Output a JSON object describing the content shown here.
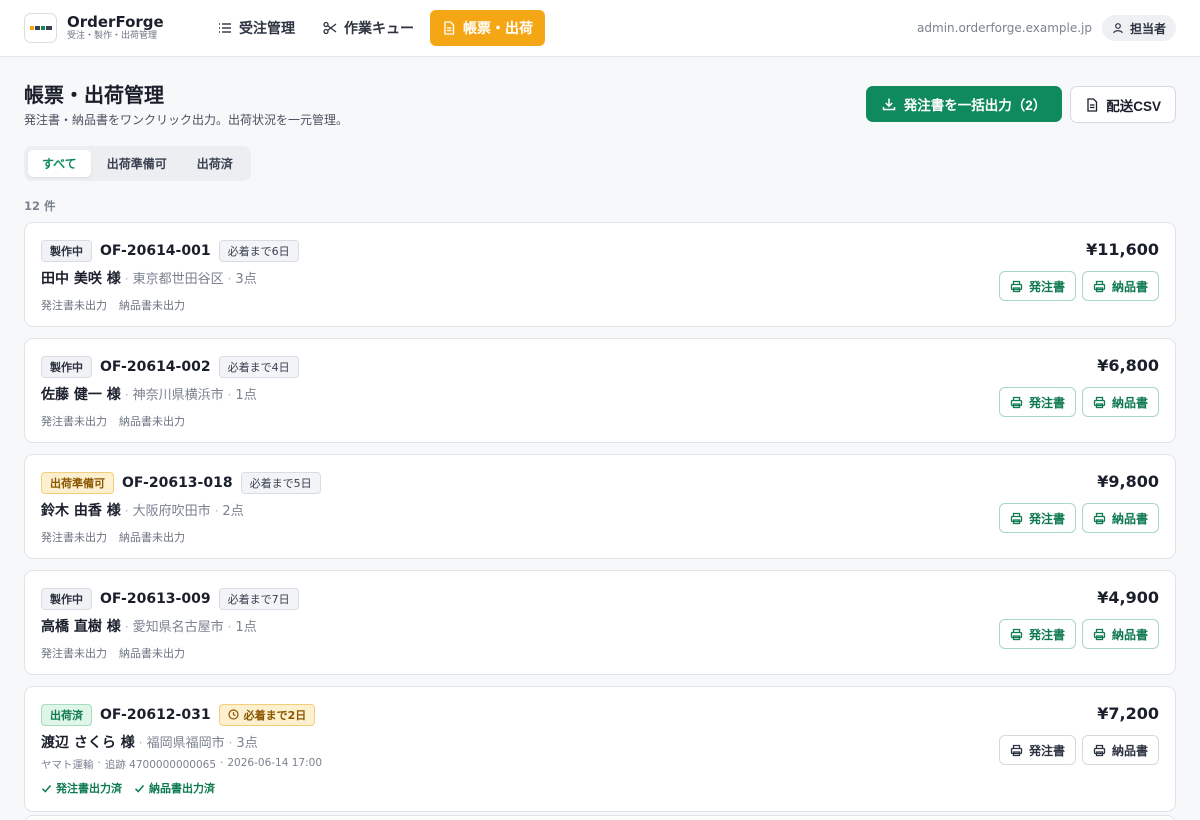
{
  "app": {
    "name": "OrderForge",
    "subtitle": "受注・製作・出荷管理",
    "logo_text": "ORDER"
  },
  "nav": [
    {
      "label": "受注管理",
      "icon": "list-icon"
    },
    {
      "label": "作業キュー",
      "icon": "scissors-icon"
    },
    {
      "label": "帳票・出荷",
      "icon": "document-icon",
      "active": true
    }
  ],
  "header": {
    "host": "admin.orderforge.example.jp",
    "user_label": "担当者"
  },
  "page": {
    "title": "帳票・出荷管理",
    "subtitle": "発注書・納品書をワンクリック出力。出荷状況を一元管理。",
    "bulk_export_label": "発注書を一括出力（2）",
    "csv_label": "配送CSV"
  },
  "tabs": [
    {
      "label": "すべて",
      "active": true
    },
    {
      "label": "出荷準備可"
    },
    {
      "label": "出荷済"
    }
  ],
  "count_label": "12 件",
  "orders": [
    {
      "status": "製作中",
      "status_type": "prod",
      "id": "OF-20614-001",
      "due": "必着まで6日",
      "due_urgent": false,
      "customer": "田中 美咲 様",
      "area": "東京都世田谷区",
      "qty": "3点",
      "po_state": "発注書未出力",
      "dn_state": "納品書未出力",
      "amount": "¥11,600",
      "po_btn": "発注書",
      "dn_btn": "納品書"
    },
    {
      "status": "製作中",
      "status_type": "prod",
      "id": "OF-20614-002",
      "due": "必着まで4日",
      "due_urgent": false,
      "customer": "佐藤 健一 様",
      "area": "神奈川県横浜市",
      "qty": "1点",
      "po_state": "発注書未出力",
      "dn_state": "納品書未出力",
      "amount": "¥6,800",
      "po_btn": "発注書",
      "dn_btn": "納品書"
    },
    {
      "status": "出荷準備可",
      "status_type": "ready",
      "id": "OF-20613-018",
      "due": "必着まで5日",
      "due_urgent": false,
      "customer": "鈴木 由香 様",
      "area": "大阪府吹田市",
      "qty": "2点",
      "po_state": "発注書未出力",
      "dn_state": "納品書未出力",
      "amount": "¥9,800",
      "po_btn": "発注書",
      "dn_btn": "納品書"
    },
    {
      "status": "製作中",
      "status_type": "prod",
      "id": "OF-20613-009",
      "due": "必着まで7日",
      "due_urgent": false,
      "customer": "高橋 直樹 様",
      "area": "愛知県名古屋市",
      "qty": "1点",
      "po_state": "発注書未出力",
      "dn_state": "納品書未出力",
      "amount": "¥4,900",
      "po_btn": "発注書",
      "dn_btn": "納品書"
    },
    {
      "status": "出荷済",
      "status_type": "shipped",
      "id": "OF-20612-031",
      "due": "必着まで2日",
      "due_urgent": true,
      "customer": "渡辺 さくら 様",
      "area": "福岡県福岡市",
      "qty": "3点",
      "carrier": "ヤマト運輸",
      "tracking": "追跡 4700000000065",
      "shipped_at": "2026-06-14 17:00",
      "po_state": "発注書出力済",
      "dn_state": "納品書出力済",
      "amount": "¥7,200",
      "po_btn": "発注書",
      "dn_btn": "納品書"
    }
  ],
  "colors": {
    "brand_green": "#0e8a5c",
    "accent_orange": "#f5a614",
    "ready_bg": "#fdf0cf",
    "shipped_bg": "#dff5e7"
  }
}
